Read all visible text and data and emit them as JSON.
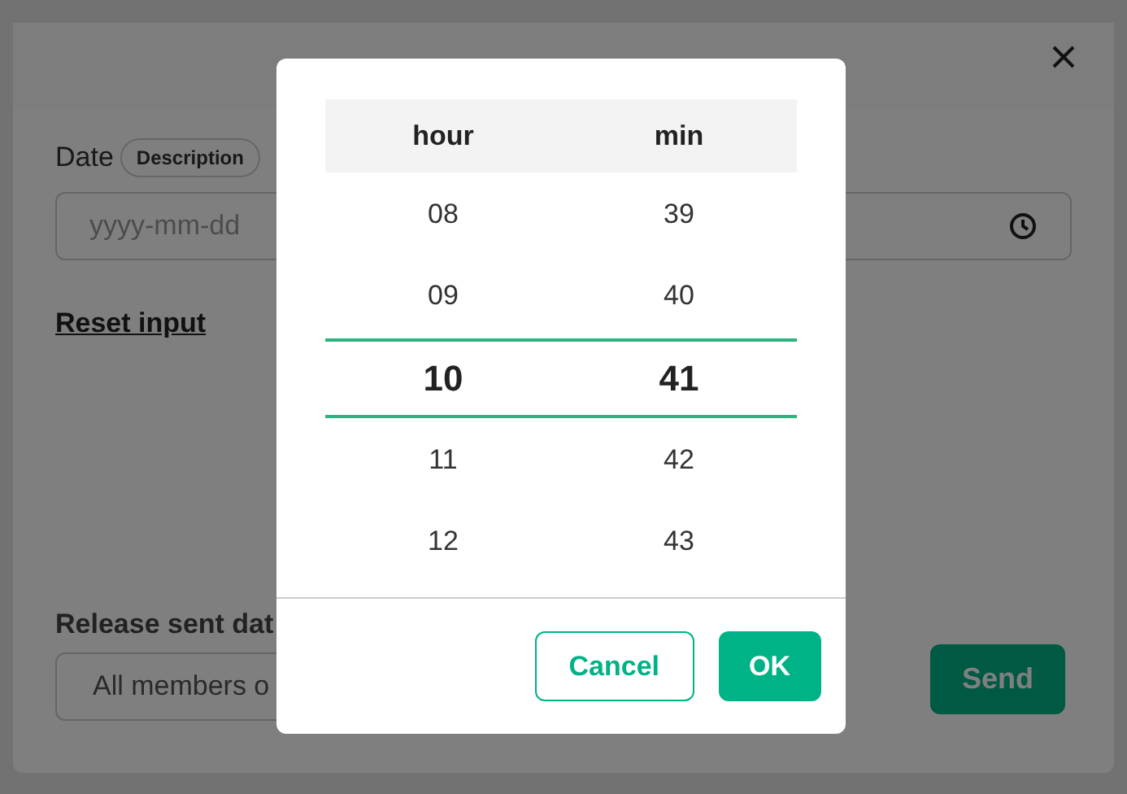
{
  "dialog": {
    "date_label": "Date",
    "description_badge": "Description",
    "date_field": {
      "placeholder": "yyyy-mm-dd"
    },
    "reset_link": "Reset input",
    "release_label": "Release sent dat",
    "release_field": {
      "value": "All members o"
    },
    "send_button": "Send"
  },
  "time_picker": {
    "columns": [
      "hour",
      "min"
    ],
    "rows": [
      {
        "hour": "08",
        "min": "39",
        "selected": false
      },
      {
        "hour": "09",
        "min": "40",
        "selected": false
      },
      {
        "hour": "10",
        "min": "41",
        "selected": true
      },
      {
        "hour": "11",
        "min": "42",
        "selected": false
      },
      {
        "hour": "12",
        "min": "43",
        "selected": false
      }
    ],
    "buttons": [
      {
        "label": "Cancel",
        "kind": "secondary"
      },
      {
        "label": "OK",
        "kind": "primary"
      }
    ]
  }
}
